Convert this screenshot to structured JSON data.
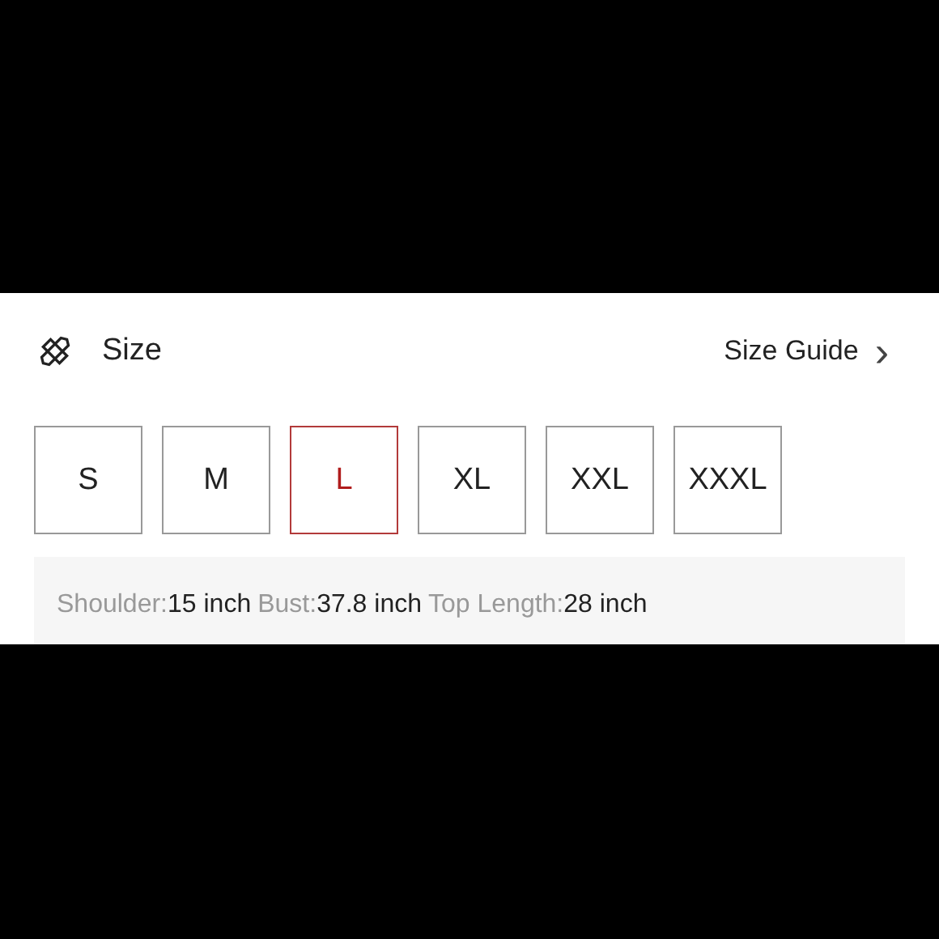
{
  "header": {
    "title": "Size",
    "guide_link": "Size Guide",
    "chevron": "›"
  },
  "sizes": [
    {
      "label": "S",
      "selected": false
    },
    {
      "label": "M",
      "selected": false
    },
    {
      "label": "L",
      "selected": true
    },
    {
      "label": "XL",
      "selected": false
    },
    {
      "label": "XXL",
      "selected": false
    },
    {
      "label": "XXXL",
      "selected": false
    }
  ],
  "measurements": [
    {
      "label": "Shoulder:",
      "value": "15 inch"
    },
    {
      "label": "Bust:",
      "value": "37.8 inch"
    },
    {
      "label": "Top Length:",
      "value": "28 inch"
    }
  ]
}
